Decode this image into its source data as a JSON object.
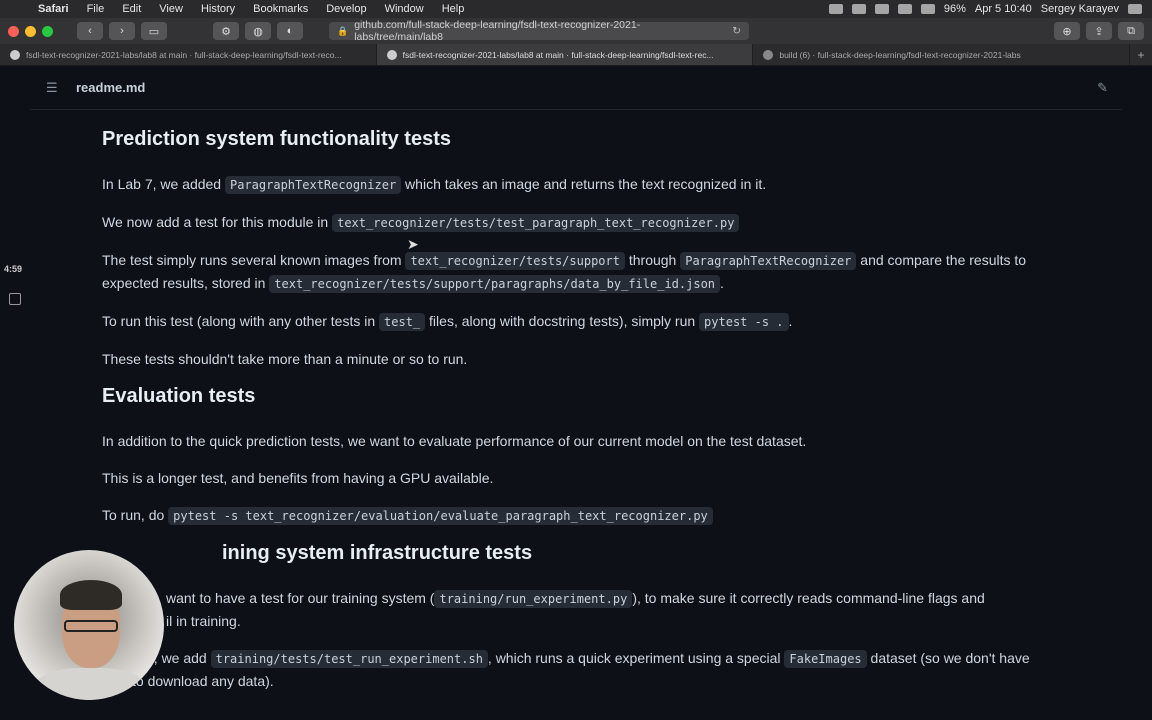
{
  "menubar": {
    "apple": "",
    "items": [
      "Safari",
      "File",
      "Edit",
      "View",
      "History",
      "Bookmarks",
      "Develop",
      "Window",
      "Help"
    ],
    "battery": "96%",
    "clock": "Apr 5  10:40",
    "user": "Sergey Karayev"
  },
  "toolbar": {
    "url": "github.com/full-stack-deep-learning/fsdl-text-recognizer-2021-labs/tree/main/lab8"
  },
  "tabs": [
    {
      "label": "fsdl-text-recognizer-2021-labs/lab8 at main · full-stack-deep-learning/fsdl-text-reco...",
      "active": false
    },
    {
      "label": "fsdl-text-recognizer-2021-labs/lab8 at main · full-stack-deep-learning/fsdl-text-rec...",
      "active": true
    },
    {
      "label": "build (6) · full-stack-deep-learning/fsdl-text-recognizer-2021-labs",
      "active": false
    }
  ],
  "file": {
    "name": "readme.md"
  },
  "side": {
    "timer": "4:59"
  },
  "readme": {
    "s1": {
      "heading": "Prediction system functionality tests",
      "p1": {
        "a": "In Lab 7, we added ",
        "c1": "ParagraphTextRecognizer",
        "b": " which takes an image and returns the text recognized in it."
      },
      "p2": {
        "a": "We now add a test for this module in ",
        "c1": "text_recognizer/tests/test_paragraph_text_recognizer.py"
      },
      "p3": {
        "a": "The test simply runs several known images from ",
        "c1": "text_recognizer/tests/support",
        "b": " through ",
        "c2": "ParagraphTextRecognizer",
        "c": " and compare the results to expected results, stored in ",
        "c3": "text_recognizer/tests/support/paragraphs/data_by_file_id.json",
        "d": "."
      },
      "p4": {
        "a": "To run this test (along with any other tests in ",
        "c1": "test_",
        "b": " files, along with docstring tests), simply run ",
        "c2": "pytest -s .",
        "c": "."
      },
      "p5": "These tests shouldn't take more than a minute or so to run."
    },
    "s2": {
      "heading": "Evaluation tests",
      "p1": "In addition to the quick prediction tests, we want to evaluate performance of our current model on the test dataset.",
      "p2": "This is a longer test, and benefits from having a GPU available.",
      "p3": {
        "a": "To run, do ",
        "c1": "pytest -s text_recognizer/evaluation/evaluate_paragraph_text_recognizer.py"
      }
    },
    "s3": {
      "heading": "ining system infrastructure tests",
      "p1": {
        "a": "want to have a test for our training system (",
        "c1": "training/run_experiment.py",
        "b": "), to make sure it correctly reads command-line flags and",
        "c": "il in training."
      },
      "p2": {
        "a": "this, we add ",
        "c1": "training/tests/test_run_experiment.sh",
        "b": ", which runs a quick experiment using a special ",
        "c2": "FakeImages",
        "c": " dataset (so we don't have to download any data)."
      }
    }
  }
}
